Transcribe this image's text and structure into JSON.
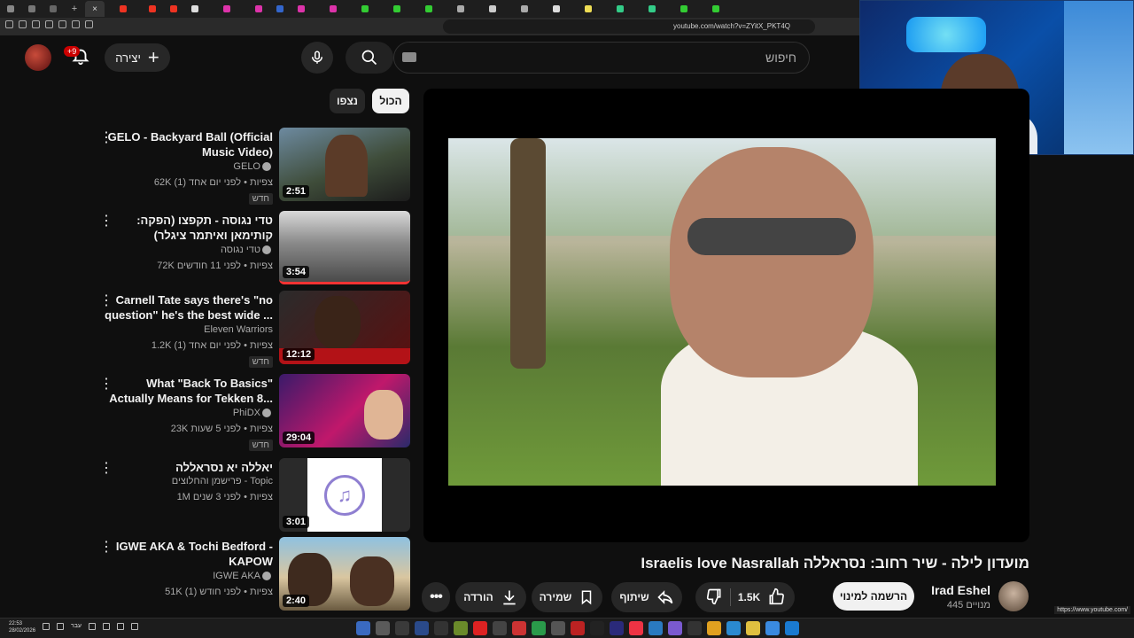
{
  "browser": {
    "url": "youtube.com/watch?v=ZYitX_PKT4Q",
    "status_url": "https://www.youtube.com/"
  },
  "header": {
    "search_placeholder": "חיפוש",
    "create_label": "יצירה",
    "notifications_badge": "+9"
  },
  "chips": {
    "all": "הכול",
    "watched": "נצפו"
  },
  "sidebar": {
    "videos": [
      {
        "title": "GELO - Backyard Ball (Official Music Video)",
        "channel": "GELO",
        "meta": "62K צפיות • לפני יום אחד (1)",
        "badge": "חדש",
        "duration": "2:51"
      },
      {
        "title": "טדי נגוסה - תקפצו (הפקה: קותימאן ואיתמר ציגלר)",
        "channel": "טדי נגוסה",
        "meta": "72K צפיות • לפני 11 חודשים",
        "badge": "",
        "duration": "3:54"
      },
      {
        "title": "Carnell Tate says there's \"no question\" he's the best wide ...",
        "channel": "Eleven Warriors",
        "meta": "1.2K צפיות • לפני יום אחד (1)",
        "badge": "חדש",
        "duration": "12:12"
      },
      {
        "title": "What \"Back To Basics\" Actually Means for Tekken 8...",
        "channel": "PhiDX",
        "meta": "23K צפיות • לפני 5 שעות",
        "badge": "חדש",
        "duration": "29:04"
      },
      {
        "title": "יאללה יא נסראללה",
        "channel": "פרישמן והחלוצים - Topic",
        "meta": "1M צפיות • לפני 3 שנים",
        "badge": "",
        "duration": "3:01"
      },
      {
        "title": "IGWE AKA & Tochi Bedford - KAPOW",
        "channel": "IGWE AKA",
        "meta": "51K צפיות • לפני חודש (1)",
        "badge": "",
        "duration": "2:40"
      }
    ]
  },
  "video": {
    "title": "מועדון לילה - שיר רחוב: נסראללה Israelis love Nasrallah",
    "channel": "Irad Eshel",
    "subs": "445 מנויים",
    "subscribe": "הרשמה למינוי",
    "likes": "1.5K",
    "share": "שיתוף",
    "save": "שמירה",
    "download": "הורדה"
  },
  "taskbar": {
    "time": "22:53",
    "date": "28/02/2026",
    "lang": "עבר"
  },
  "colors": {
    "background": "#0f0f0f",
    "accent_red": "#cc0000",
    "pill": "#272727"
  }
}
